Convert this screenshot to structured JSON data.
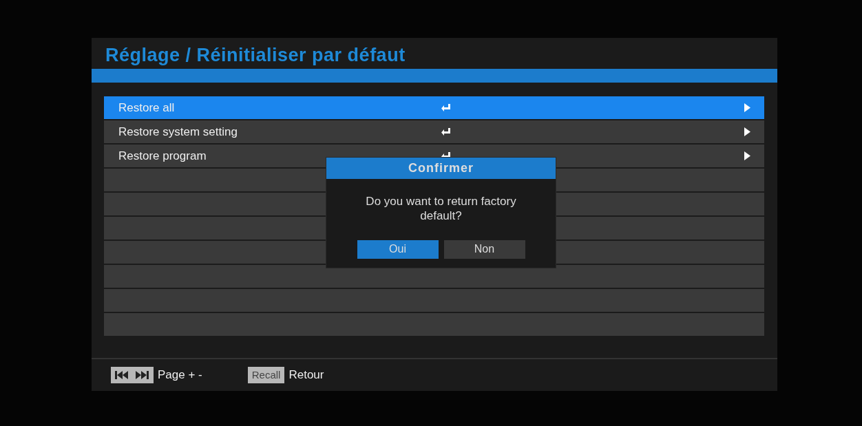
{
  "title": "Réglage / Réinitialiser par défaut",
  "items": [
    {
      "label": "Restore all",
      "selected": true
    },
    {
      "label": "Restore system setting",
      "selected": false
    },
    {
      "label": "Restore program",
      "selected": false
    }
  ],
  "dialog": {
    "title": "Confirmer",
    "message": "Do you want to return factory default?",
    "buttons": [
      {
        "label": "Oui",
        "selected": true
      },
      {
        "label": "Non",
        "selected": false
      }
    ]
  },
  "footer": [
    {
      "kind": "skip",
      "text": "Page + -"
    },
    {
      "kind": "key",
      "key": "Recall",
      "text": "Retour"
    }
  ]
}
